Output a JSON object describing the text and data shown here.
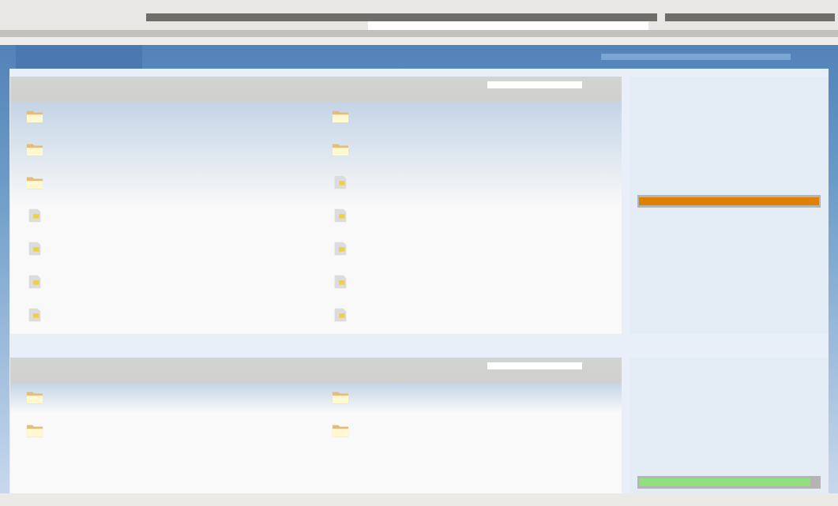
{
  "sections": [
    {
      "rows": [
        {
          "left": {
            "kind": "folder"
          },
          "right": {
            "kind": "folder"
          }
        },
        {
          "left": {
            "kind": "folder"
          },
          "right": {
            "kind": "folder"
          }
        },
        {
          "left": {
            "kind": "folder"
          },
          "right": {
            "kind": "page"
          }
        },
        {
          "left": {
            "kind": "page"
          },
          "right": {
            "kind": "page"
          }
        },
        {
          "left": {
            "kind": "page"
          },
          "right": {
            "kind": "page"
          }
        },
        {
          "left": {
            "kind": "page"
          },
          "right": {
            "kind": "page"
          }
        },
        {
          "left": {
            "kind": "page"
          },
          "right": {
            "kind": "page"
          }
        }
      ],
      "sidebar": {
        "meter": {
          "level": 1,
          "color": "#e08000"
        }
      }
    },
    {
      "rows": [
        {
          "left": {
            "kind": "folder"
          },
          "right": {
            "kind": "folder"
          }
        },
        {
          "left": {
            "kind": "folder"
          },
          "right": {
            "kind": "folder"
          }
        }
      ],
      "sidebar": {
        "meter": {
          "level": 0.95,
          "color": "#90e080"
        }
      }
    }
  ]
}
